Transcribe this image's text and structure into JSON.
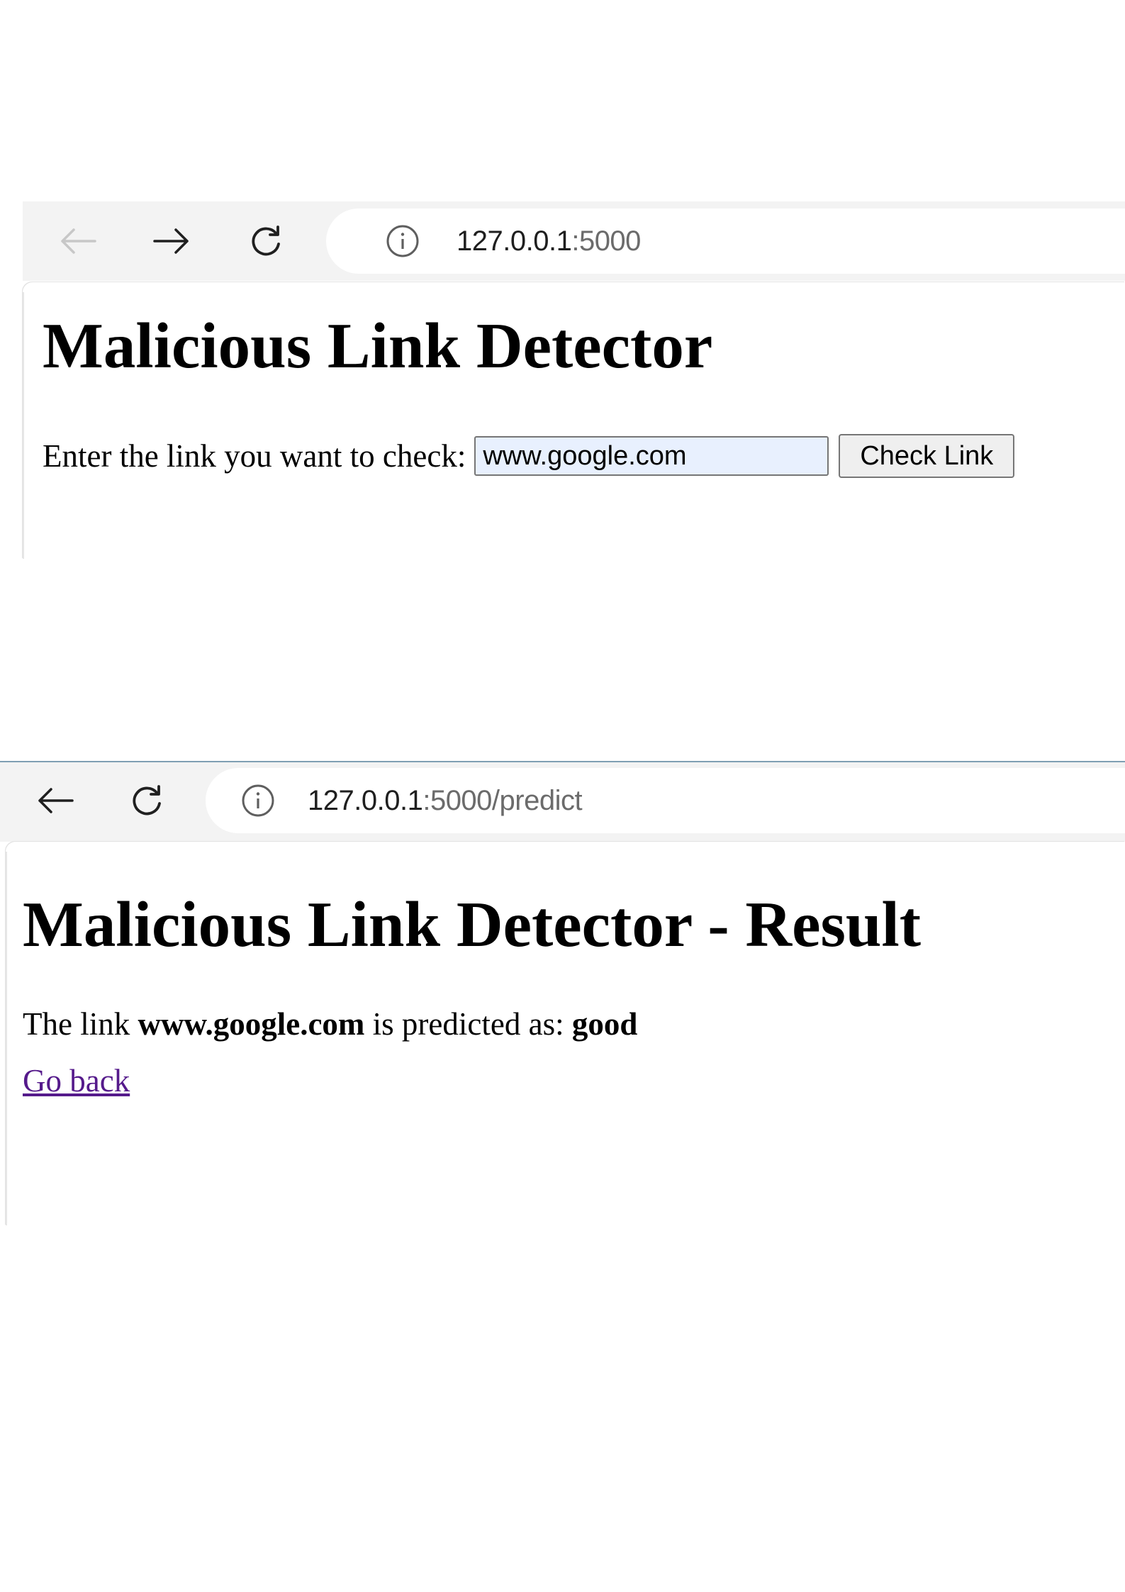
{
  "screens": [
    {
      "address_bar": {
        "host": "127.0.0.1",
        "rest": ":5000"
      },
      "page": {
        "heading": "Malicious Link Detector",
        "form": {
          "label": "Enter the link you want to check:",
          "input_value": "www.google.com",
          "button_label": "Check Link"
        }
      }
    },
    {
      "address_bar": {
        "host": "127.0.0.1",
        "rest": ":5000/predict"
      },
      "page": {
        "heading": "Malicious Link Detector - Result",
        "result": {
          "prefix": "The link",
          "link": "www.google.com",
          "middle": "is predicted as:",
          "prediction": "good"
        },
        "go_back_label": "Go back"
      }
    }
  ],
  "icons": {
    "back": "arrow-left-icon",
    "forward": "arrow-right-icon",
    "reload": "reload-icon",
    "site_info": "info-icon"
  },
  "colors": {
    "toolbar": "#f3f3f3",
    "input_autofill": "#e8f0fe",
    "visited_link": "#551a8b"
  }
}
